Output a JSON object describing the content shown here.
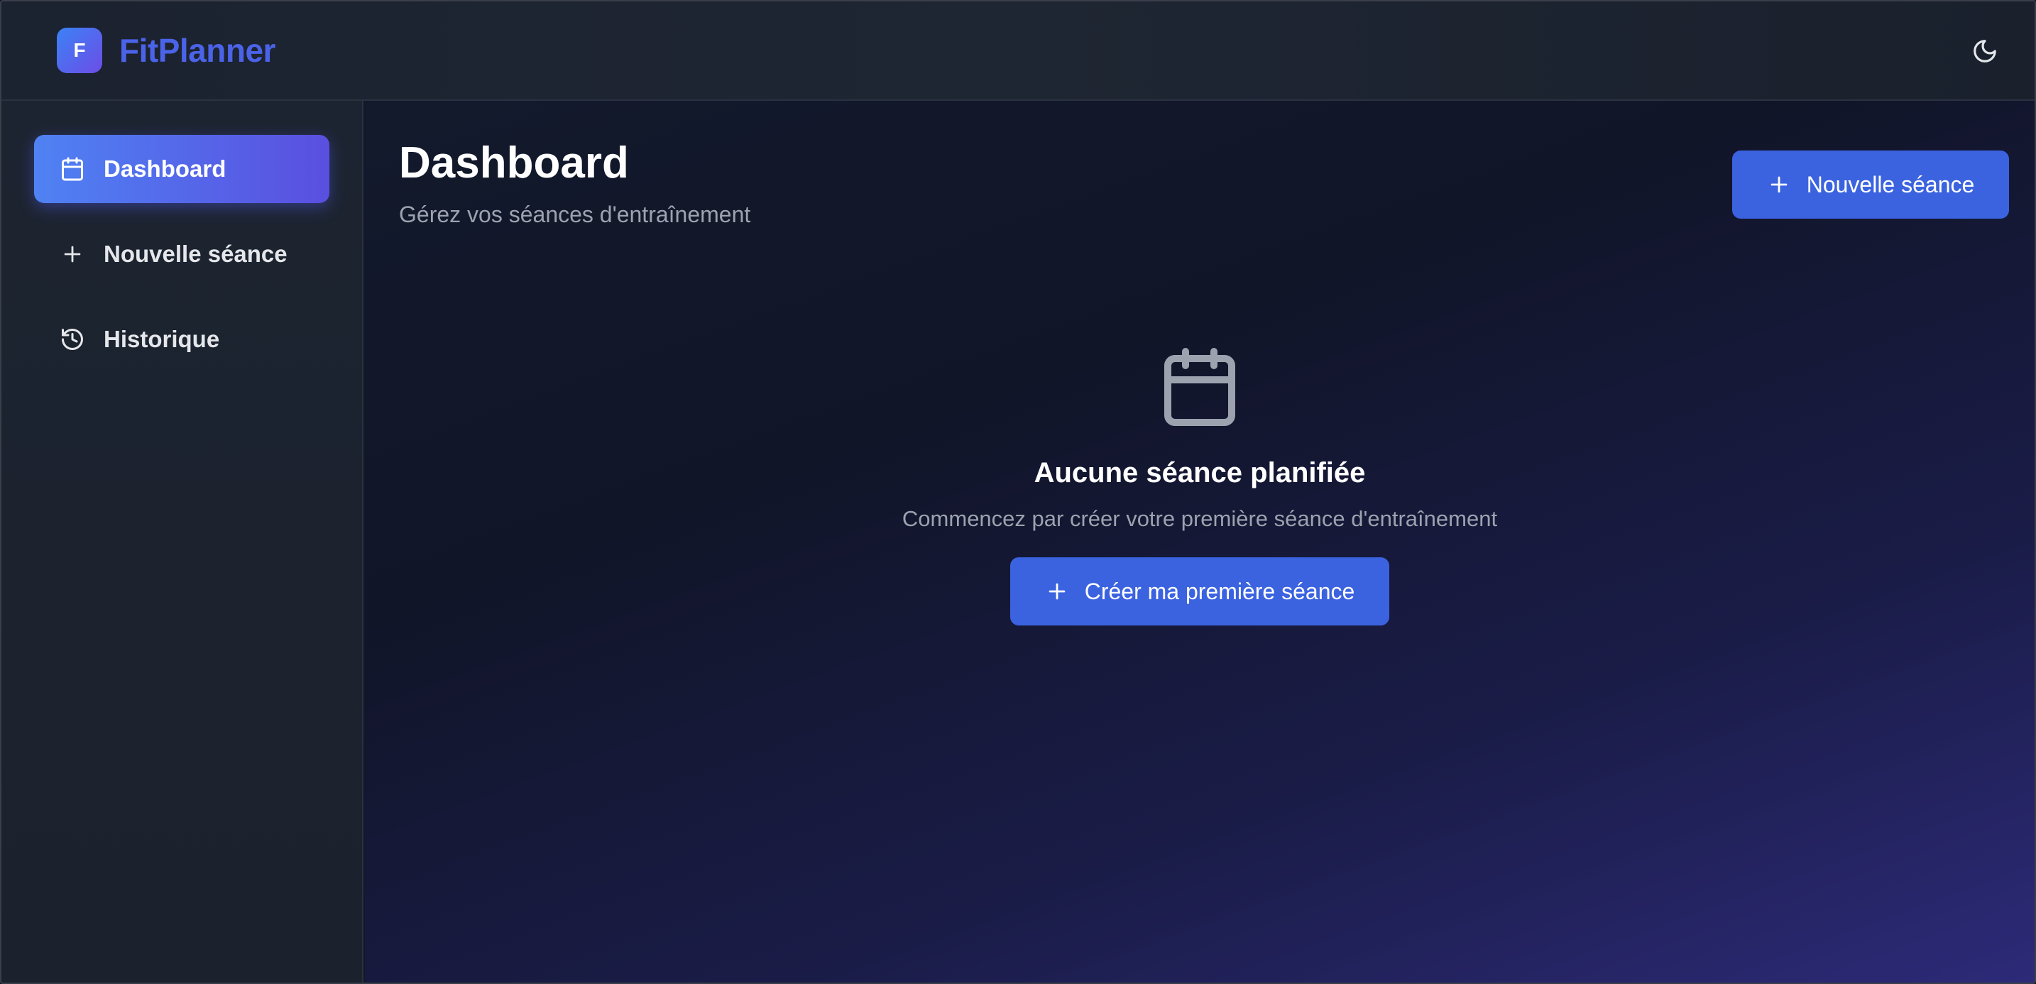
{
  "header": {
    "logo_letter": "F",
    "brand_name": "FitPlanner",
    "theme_toggle_icon": "moon-icon"
  },
  "sidebar": {
    "items": [
      {
        "label": "Dashboard",
        "icon": "calendar-icon",
        "active": true
      },
      {
        "label": "Nouvelle séance",
        "icon": "plus-icon",
        "active": false
      },
      {
        "label": "Historique",
        "icon": "history-icon",
        "active": false
      }
    ]
  },
  "main": {
    "title": "Dashboard",
    "subtitle": "Gérez vos séances d'entraînement",
    "new_button_label": "Nouvelle séance",
    "empty_state": {
      "icon": "calendar-icon",
      "title": "Aucune séance planifiée",
      "text": "Commencez par créer votre première séance d'entraînement",
      "button_label": "Créer ma première séance"
    }
  },
  "colors": {
    "accent": "#3b63e0",
    "brand": "#4b63e8",
    "active_nav_gradient_start": "#4f82f3",
    "active_nav_gradient_end": "#5a4fe0"
  }
}
